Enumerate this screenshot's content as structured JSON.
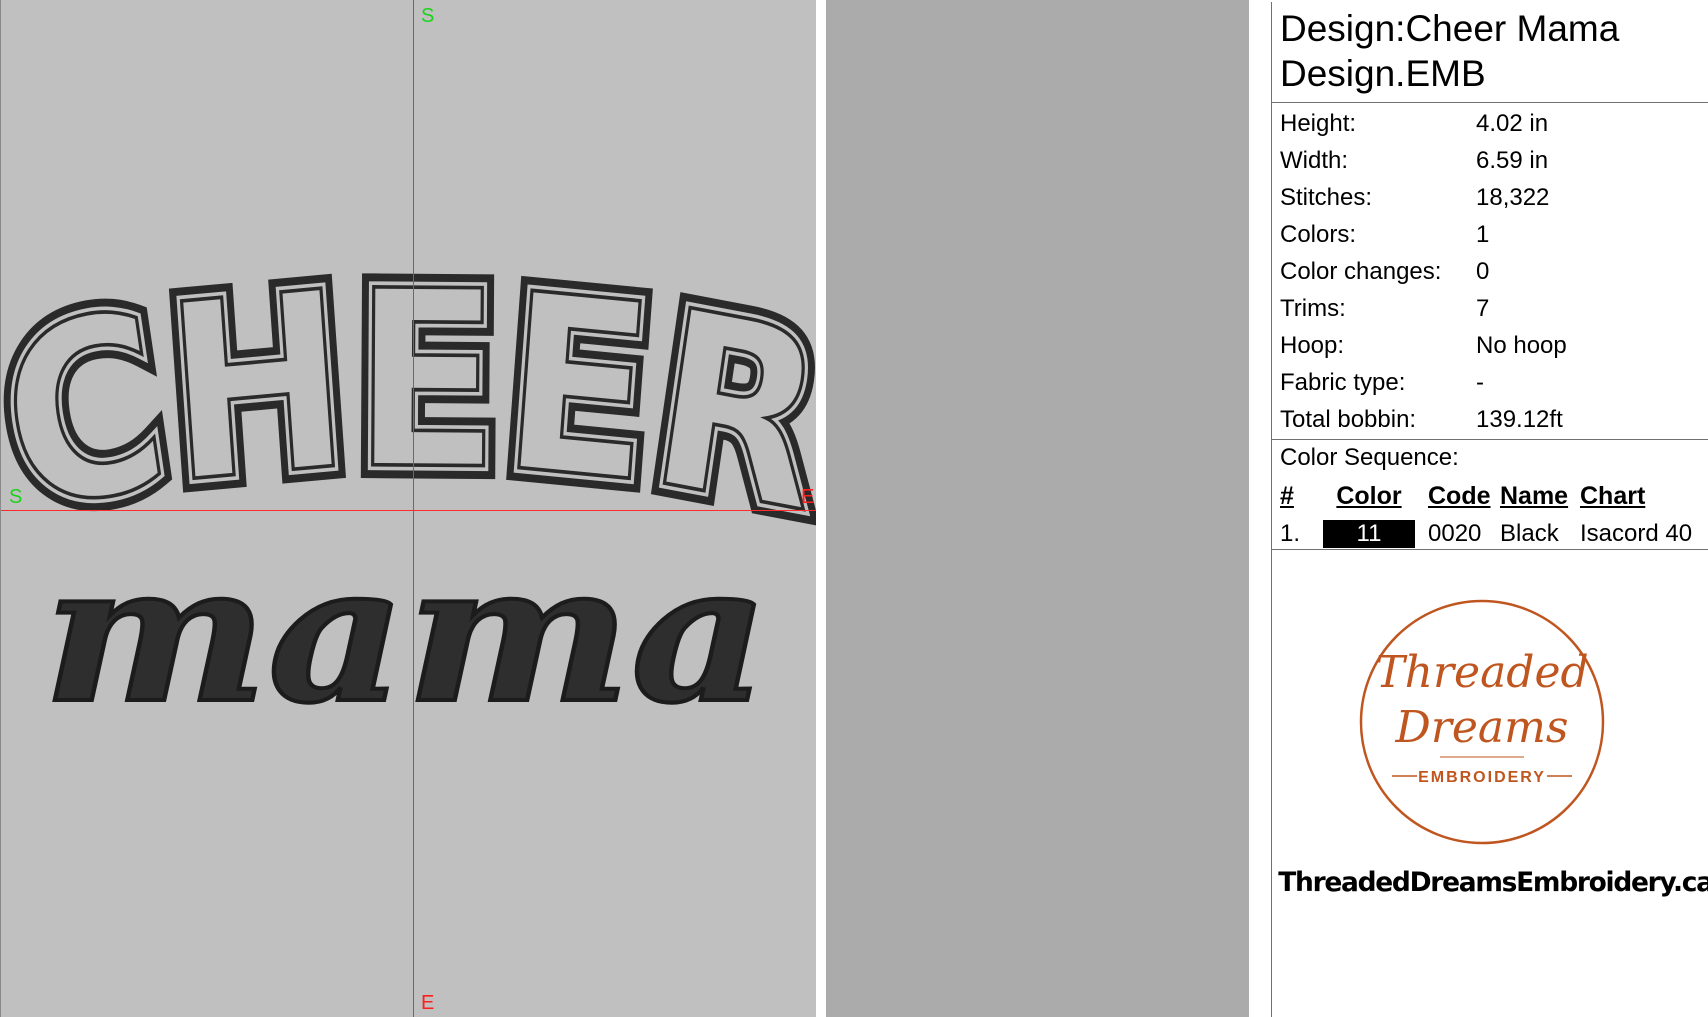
{
  "canvas": {
    "axis_top_label": "S",
    "axis_bottom_label": "E",
    "axis_left_label": "S",
    "axis_right_label": "E",
    "design_text_top": "CHEER",
    "design_text_bottom": "mama",
    "background_color": "#c0c0c0",
    "guide_color": "#ff2a2a",
    "thread_color": "#2a2a2a"
  },
  "info": {
    "design_name": "Design:Cheer Mama",
    "file_name": "Design.EMB",
    "properties": [
      {
        "label": "Height:",
        "value": "4.02 in"
      },
      {
        "label": "Width:",
        "value": "6.59 in"
      },
      {
        "label": "Stitches:",
        "value": "18,322"
      },
      {
        "label": "Colors:",
        "value": "1"
      },
      {
        "label": "Color changes:",
        "value": "0"
      },
      {
        "label": "Trims:",
        "value": "7"
      },
      {
        "label": "Hoop:",
        "value": "No hoop"
      },
      {
        "label": "Fabric type:",
        "value": "-"
      },
      {
        "label": "Total bobbin:",
        "value": "139.12ft"
      }
    ],
    "color_sequence_title": "Color Sequence:",
    "sequence_headers": {
      "num": "#",
      "color": "Color",
      "code": "Code",
      "name": "Name",
      "chart": "Chart"
    },
    "sequence": [
      {
        "num": "1.",
        "color_label": "11",
        "swatch": "#000000",
        "code": "0020",
        "name": "Black",
        "chart": "Isacord 40"
      }
    ]
  },
  "logo": {
    "line1": "Threaded",
    "line2": "Dreams",
    "line3": "EMBROIDERY",
    "color": "#c0561f"
  },
  "website": "ThreadedDreamsEmbroidery.ca"
}
